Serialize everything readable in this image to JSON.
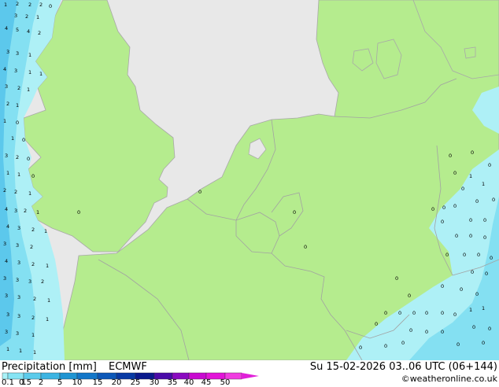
{
  "footer": {
    "title": "Precipitation [mm]",
    "model": "ECMWF",
    "valid_time": "Su 15-02-2026 03..06 UTC (06+144)",
    "credit": "©weatheronline.co.uk"
  },
  "legend": {
    "labels": [
      "0.1",
      "0.5",
      "1",
      "2",
      "5",
      "10",
      "15",
      "20",
      "25",
      "30",
      "35",
      "40",
      "45",
      "50"
    ],
    "colors": [
      "#aaf2f8",
      "#86e4f4",
      "#5ccbeb",
      "#3cb4e2",
      "#1e94d2",
      "#1276c8",
      "#0c58b8",
      "#083aa4",
      "#0a1a8c",
      "#4a0aa8",
      "#8a0ac0",
      "#c80ad0",
      "#e214d8",
      "#f03ce0"
    ]
  },
  "map": {
    "sea_color": "#e8e8e8",
    "land_color": "#b5ec8e",
    "light_precip_color": "#aef0f6",
    "medium_precip_color": "#84e0f2",
    "heavy_precip_color": "#5cc8ec",
    "border_color": "#a2a2a2"
  }
}
